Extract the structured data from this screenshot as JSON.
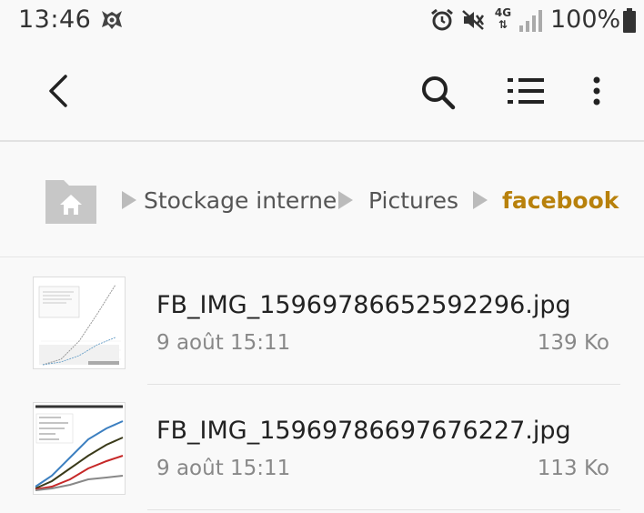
{
  "status_bar": {
    "time": "13:46",
    "network": "4G",
    "battery_percent": "100%"
  },
  "breadcrumb": {
    "items": [
      "Stockage interne",
      "Pictures",
      "facebook"
    ],
    "active_color": "#b8810c"
  },
  "files": [
    {
      "name": "FB_IMG_15969786652592296.jpg",
      "date": "9 août 15:11",
      "size": "139 Ko"
    },
    {
      "name": "FB_IMG_15969786697676227.jpg",
      "date": "9 août 15:11",
      "size": "113 Ko"
    }
  ]
}
